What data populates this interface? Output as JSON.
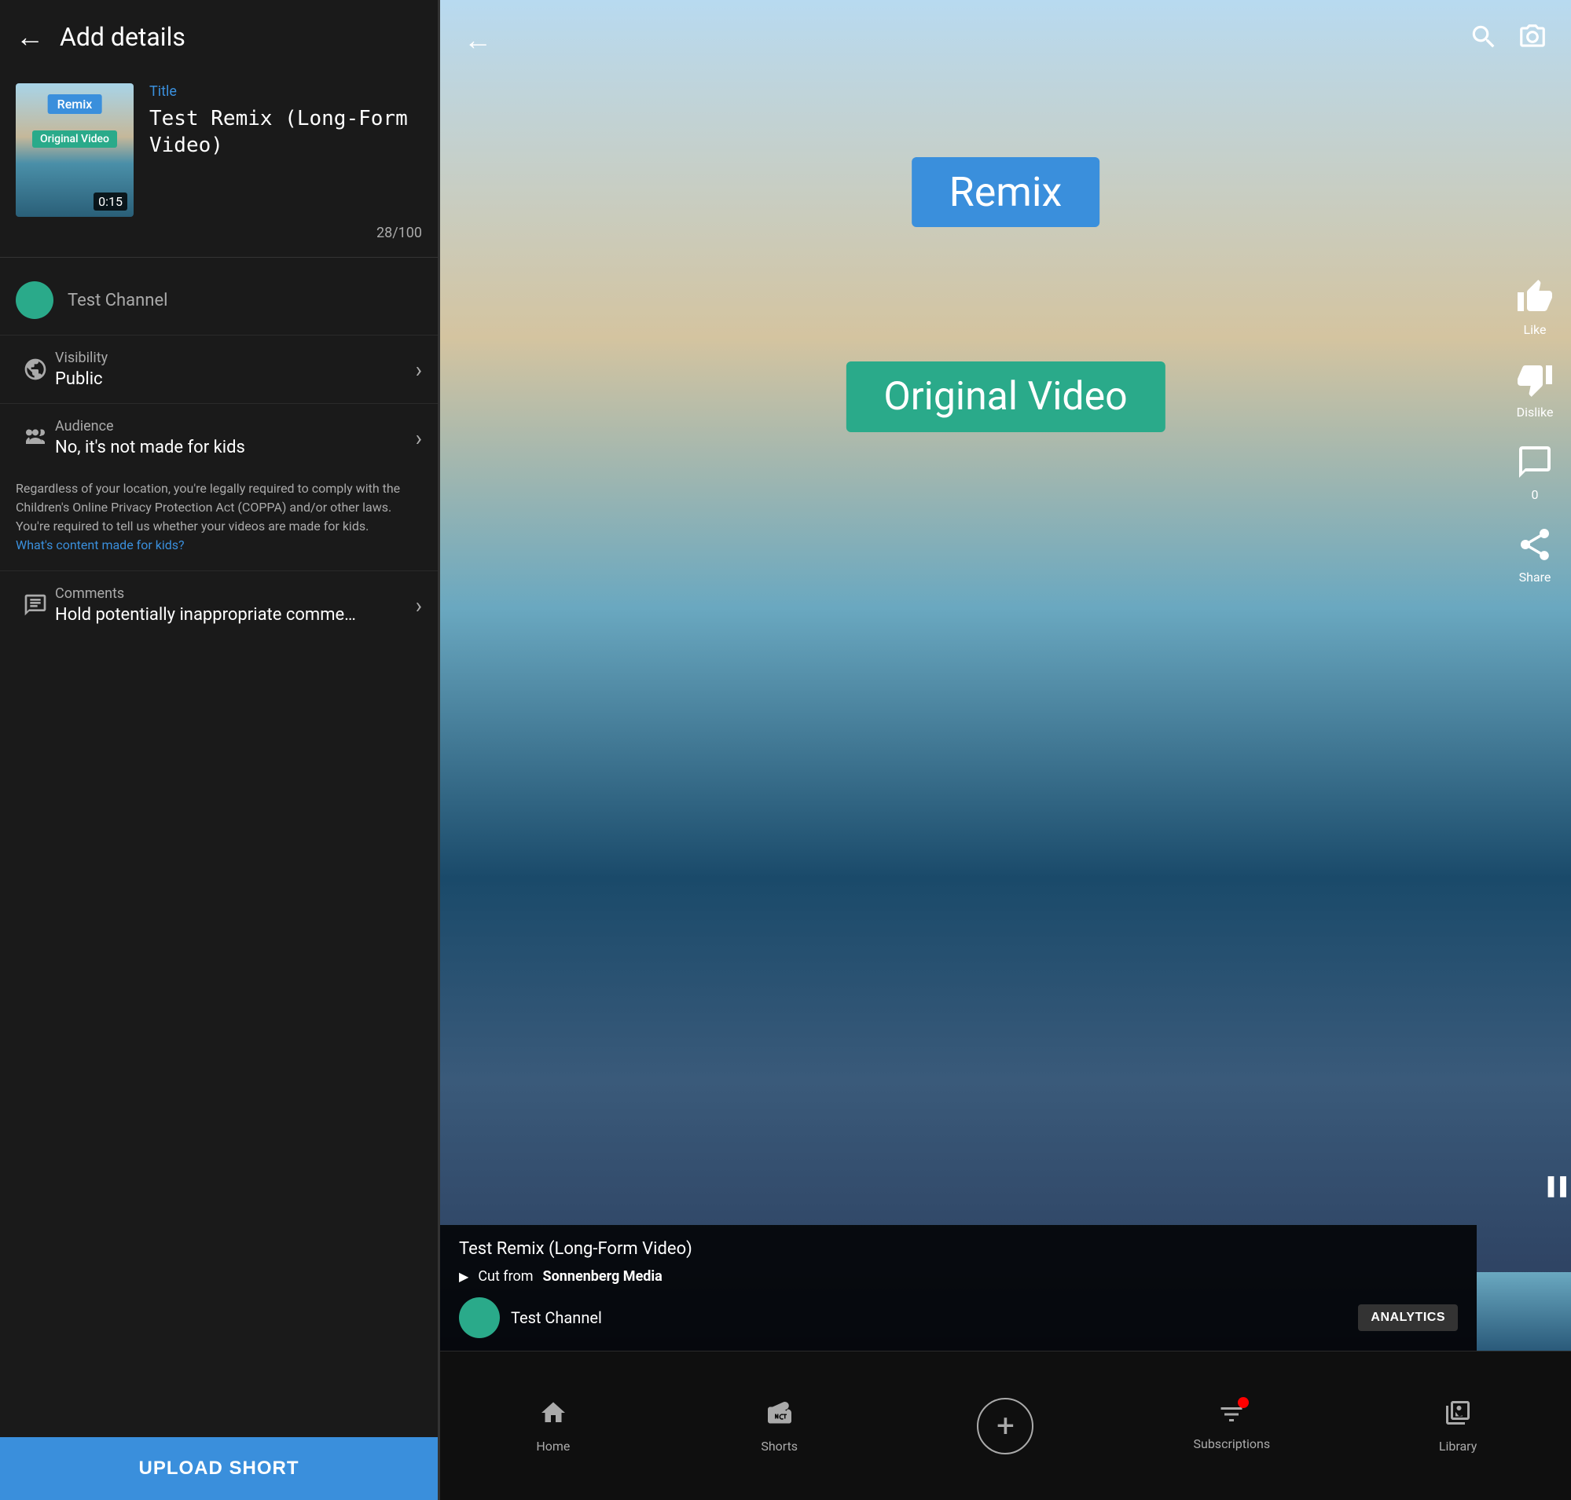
{
  "left": {
    "header": {
      "back_label": "←",
      "title": "Add details"
    },
    "video": {
      "thumbnail": {
        "remix_badge": "Remix",
        "original_badge": "Original Video",
        "duration": "0:15"
      },
      "title_label": "Title",
      "title_value": "Test Remix (Long-Form Video)",
      "char_count": "28/100"
    },
    "channel": {
      "name": "Test Channel"
    },
    "visibility": {
      "label": "Visibility",
      "value": "Public"
    },
    "audience": {
      "label": "Audience",
      "value": "No, it's not made for kids"
    },
    "coppa_text": "Regardless of your location, you're legally required to comply with the Children's Online Privacy Protection Act (COPPA) and/or other laws. You're required to tell us whether your videos are made for kids.",
    "coppa_link": "What's content made for kids?",
    "comments": {
      "label": "Comments",
      "value": "Hold potentially inappropriate comme…"
    },
    "upload_btn": "UPLOAD SHORT"
  },
  "right": {
    "header": {
      "back_label": "←"
    },
    "video": {
      "remix_badge": "Remix",
      "original_badge": "Original Video"
    },
    "actions": {
      "like_label": "Like",
      "dislike_label": "Dislike",
      "comments_label": "0",
      "share_label": "Share"
    },
    "info": {
      "title": "Test Remix (Long-Form Video)",
      "cut_from_prefix": "Cut from",
      "cut_from_channel": "Sonnenberg Media",
      "channel_name": "Test Channel",
      "analytics_btn": "ANALYTICS"
    },
    "nav": {
      "home_label": "Home",
      "shorts_label": "Shorts",
      "subscriptions_label": "Subscriptions",
      "library_label": "Library"
    }
  }
}
